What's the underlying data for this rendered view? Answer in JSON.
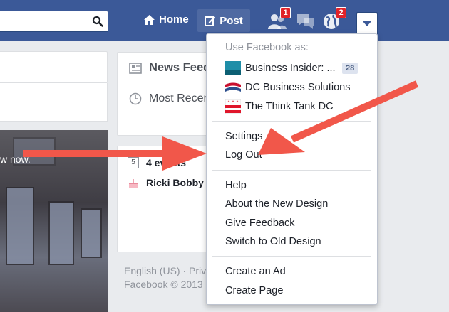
{
  "topbar": {
    "home_label": "Home",
    "post_label": "Post",
    "friend_badge": "1",
    "notif_badge": "2"
  },
  "photo": {
    "caption": "w now."
  },
  "middle": {
    "news_feed": "News Feed",
    "most_recent": "Most Recent",
    "events_day": "5",
    "events": "4 events",
    "birthday": "Ricki Bobby",
    "footer_lang": "English (US) · Privacy",
    "footer_copy": "Facebook © 2013"
  },
  "menu": {
    "use_as_header": "Use Facebook as:",
    "pages": [
      {
        "name": "Business Insider: ...",
        "count": "28"
      },
      {
        "name": "DC Business Solutions"
      },
      {
        "name": "The Think Tank DC"
      }
    ],
    "settings": "Settings",
    "log_out": "Log Out",
    "help": "Help",
    "about_design": "About the New Design",
    "give_feedback": "Give Feedback",
    "switch_old": "Switch to Old Design",
    "create_ad": "Create an Ad",
    "create_page": "Create Page"
  },
  "colors": {
    "brand": "#3b5998",
    "badge": "#e1232a",
    "arrow": "#f1574a"
  }
}
